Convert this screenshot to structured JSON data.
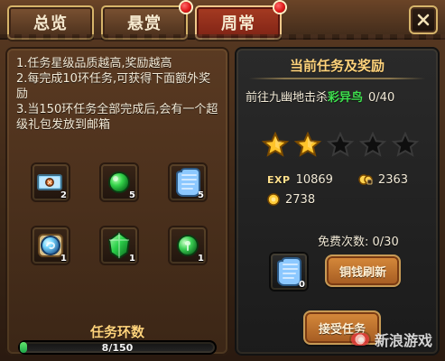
{
  "tabs": [
    {
      "label": "总览"
    },
    {
      "label": "悬赏"
    },
    {
      "label": "周常"
    }
  ],
  "rules": [
    "1.任务星级品质越高,奖励越高",
    "2.每完成10环任务,可获得下面额外奖励",
    "3.当150环任务全部完成后,会有一个超级礼包发放到邮箱"
  ],
  "extra_rewards": [
    {
      "icon": "card-icon",
      "qty": "2"
    },
    {
      "icon": "green-orb-icon",
      "qty": "5"
    },
    {
      "icon": "scroll-icon",
      "qty": "5"
    },
    {
      "icon": "blue-swirl-icon",
      "qty": "1"
    },
    {
      "icon": "green-gem-icon",
      "qty": "1"
    },
    {
      "icon": "clover-orb-icon",
      "qty": "1"
    }
  ],
  "progress": {
    "label": "任务环数",
    "text": "8/150",
    "value": 8,
    "max": 150
  },
  "current_task": {
    "title": "当前任务及奖励",
    "objective_prefix": "前往九幽地击杀",
    "objective_target": "彩异鸟",
    "objective_count": "0/40",
    "stars_filled": 2,
    "stars_total": 5,
    "exp_label": "EXP",
    "exp_value": "10869",
    "coin_value": "2363",
    "copper_value": "2738"
  },
  "free_refresh": {
    "label": "免费次数:",
    "value": "0/30",
    "scroll_qty": "0"
  },
  "buttons": {
    "refresh": "铜钱刷新",
    "accept": "接受任务"
  },
  "watermark": {
    "text": "新浪游戏"
  }
}
